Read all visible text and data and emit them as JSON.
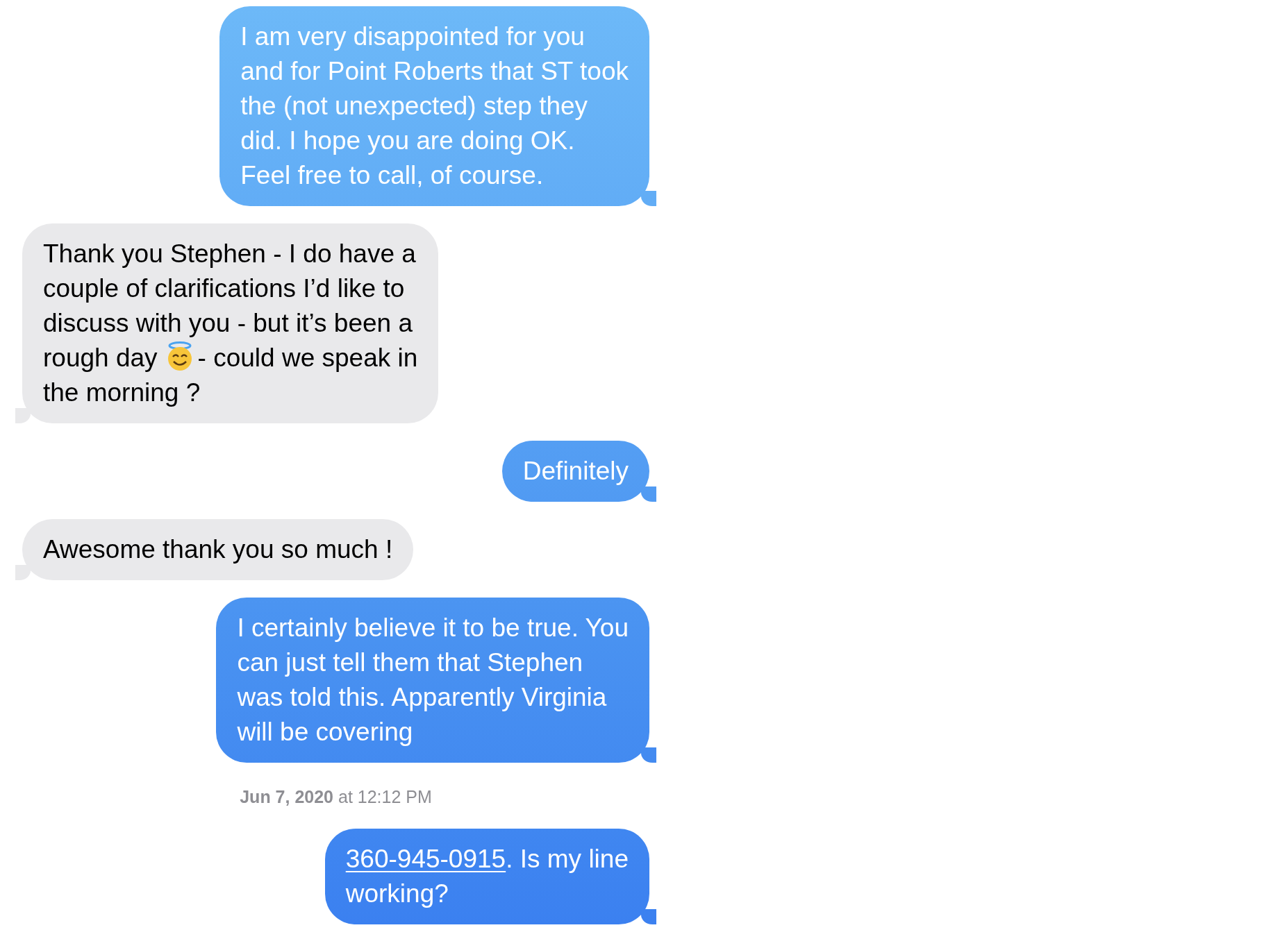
{
  "messages": [
    {
      "kind": "sent",
      "lines": [
        [
          {
            "kind": "text",
            "text": "I am very disappointed for you"
          }
        ],
        [
          {
            "kind": "text",
            "text": "and for Point Roberts that ST took"
          }
        ],
        [
          {
            "kind": "text",
            "text": "the (not unexpected) step they"
          }
        ],
        [
          {
            "kind": "text",
            "text": "did.  I hope you are doing OK."
          }
        ],
        [
          {
            "kind": "text",
            "text": "Feel free to call, of course."
          }
        ]
      ]
    },
    {
      "kind": "received",
      "lines": [
        [
          {
            "kind": "text",
            "text": "Thank you Stephen - I do have a"
          }
        ],
        [
          {
            "kind": "text",
            "text": "couple of clarifications I’d like to"
          }
        ],
        [
          {
            "kind": "text",
            "text": "discuss with you - but it’s been a"
          }
        ],
        [
          {
            "kind": "text",
            "text": "rough day"
          },
          {
            "kind": "emoji"
          },
          {
            "kind": "text",
            "text": "- could we speak in"
          }
        ],
        [
          {
            "kind": "text",
            "text": "the morning ?"
          }
        ]
      ]
    },
    {
      "kind": "sent",
      "lines": [
        [
          {
            "kind": "text",
            "text": "Definitely"
          }
        ]
      ]
    },
    {
      "kind": "received",
      "lines": [
        [
          {
            "kind": "text",
            "text": "Awesome thank you so much !"
          }
        ]
      ]
    },
    {
      "kind": "sent",
      "lines": [
        [
          {
            "kind": "text",
            "text": "I certainly believe it to be true. You"
          }
        ],
        [
          {
            "kind": "text",
            "text": "can just tell them that Stephen"
          }
        ],
        [
          {
            "kind": "text",
            "text": "was told this. Apparently Virginia"
          }
        ],
        [
          {
            "kind": "text",
            "text": "will be covering"
          }
        ]
      ]
    },
    {
      "kind": "timestamp",
      "text": "**Jun 7, 2020** at 12:12 PM"
    },
    {
      "kind": "sent",
      "lines": [
        [
          {
            "kind": "link",
            "text": "360-945-0915"
          },
          {
            "kind": "text",
            "text": ".  Is my line"
          }
        ],
        [
          {
            "kind": "text",
            "text": "working?"
          }
        ]
      ]
    }
  ]
}
